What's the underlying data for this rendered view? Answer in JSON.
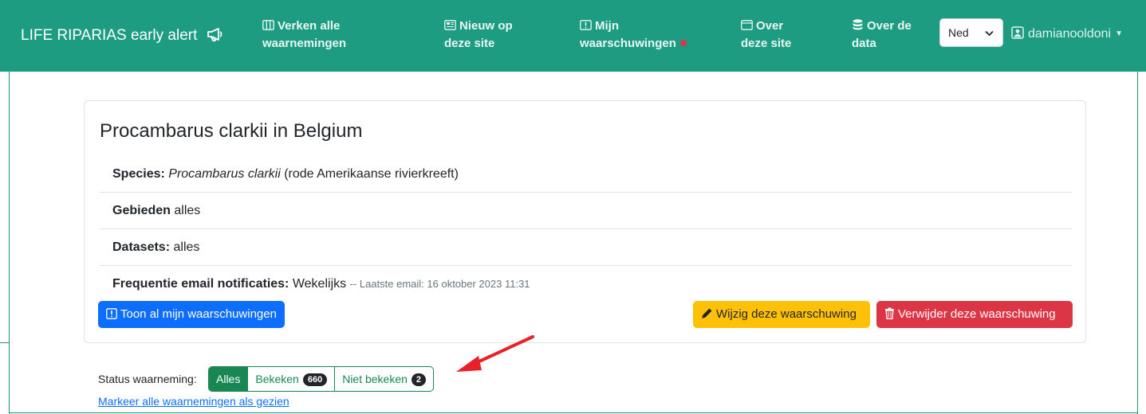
{
  "navbar": {
    "brand": "LIFE RIPARIAS early alert",
    "items": [
      {
        "line1": "Verken alle",
        "line2": "waarnemingen",
        "icon": "columns-icon"
      },
      {
        "line1": "Nieuw op",
        "line2": "deze site",
        "icon": "news-icon"
      },
      {
        "line1": "Mijn",
        "line2": "waarschuwingen",
        "icon": "alert-square-icon"
      },
      {
        "line1": "Over",
        "line2": "deze site",
        "icon": "window-icon"
      },
      {
        "line1": "Over de",
        "line2": "data",
        "icon": "database-icon"
      }
    ],
    "language": "Ned",
    "username": "damianooldoni",
    "alert_dot_color": "#dc3545"
  },
  "alert": {
    "title": "Procambarus clarkii in Belgium",
    "species_label": "Species:",
    "species_scientific": "Procambarus clarkii",
    "species_vernacular": "(rode Amerikaanse rivierkreeft)",
    "areas_label": "Gebieden",
    "areas_value": "alles",
    "datasets_label": "Datasets:",
    "datasets_value": "alles",
    "frequency_label": "Frequentie email notificaties:",
    "frequency_value": "Wekelijks",
    "last_email": "-- Laatste email: 16 oktober 2023 11:31",
    "buttons": {
      "show_all": "Toon al mijn waarschuwingen",
      "edit": "Wijzig deze waarschuwing",
      "delete": "Verwijder deze waarschuwing"
    }
  },
  "status_filter": {
    "label": "Status waarneming:",
    "options": [
      {
        "label": "Alles",
        "active": true
      },
      {
        "label": "Bekeken",
        "count": "660"
      },
      {
        "label": "Niet bekeken",
        "count": "2"
      }
    ],
    "mark_all_link": "Markeer alle waarnemingen als gezien"
  },
  "colors": {
    "navbar": "#1e9c82",
    "primary": "#0d6efd",
    "warning": "#ffc107",
    "danger": "#dc3545",
    "success": "#198754",
    "annotation_arrow": "#e8202a"
  }
}
